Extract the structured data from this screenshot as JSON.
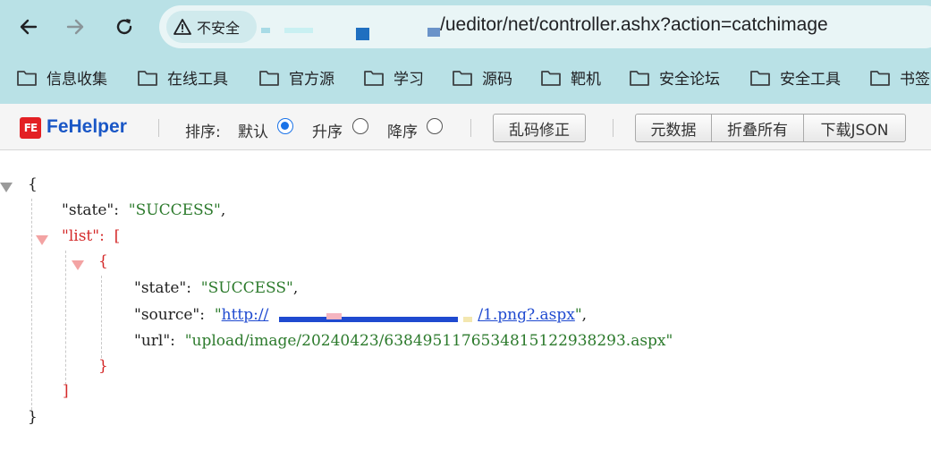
{
  "browser": {
    "security_label": "不安全",
    "url": "/ueditor/net/controller.ashx?action=catchimage"
  },
  "bookmarks": [
    "信息收集",
    "在线工具",
    "官方源",
    "学习",
    "源码",
    "靶机",
    "安全论坛",
    "安全工具",
    "书签"
  ],
  "fehelper": {
    "logo_text": "FE",
    "name": "FeHelper",
    "sort_label": "排序:",
    "sort_default": "默认",
    "sort_asc": "升序",
    "sort_desc": "降序",
    "fix_encoding": "乱码修正",
    "metadata": "元数据",
    "fold_all": "折叠所有",
    "download_json": "下载JSON"
  },
  "json_view": {
    "open_brace": "{",
    "close_brace": "}",
    "open_bracket": "[",
    "close_bracket": "]",
    "key_state": "\"state\"",
    "val_success": "\"SUCCESS\"",
    "key_list": "\"list\"",
    "key_source": "\"source\"",
    "source_link": "http://",
    "source_tail": "/1.png?.aspx",
    "key_url": "\"url\"",
    "val_url": "\"upload/image/20240423/6384951176534815122938293.aspx\""
  }
}
